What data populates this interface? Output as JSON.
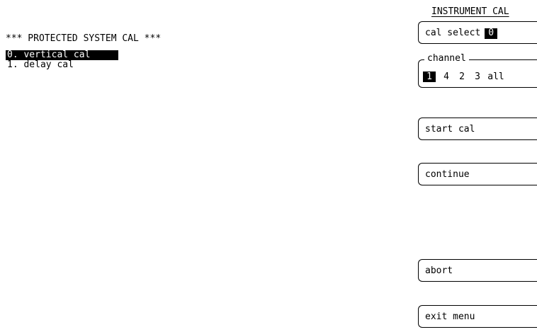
{
  "list": {
    "header": "*** PROTECTED SYSTEM CAL ***",
    "items": [
      {
        "label": "0. vertical cal",
        "selected": true
      },
      {
        "label": "1. delay cal",
        "selected": false
      }
    ]
  },
  "menu": {
    "title": "INSTRUMENT CAL",
    "cal_select": {
      "label": "cal select",
      "value": "0"
    },
    "channel": {
      "legend": "channel",
      "options": [
        "1",
        "4",
        "2",
        "3",
        "all"
      ],
      "selected": "1"
    },
    "start_cal": "start cal",
    "continue": "continue",
    "abort": "abort",
    "exit_menu": "exit menu"
  }
}
